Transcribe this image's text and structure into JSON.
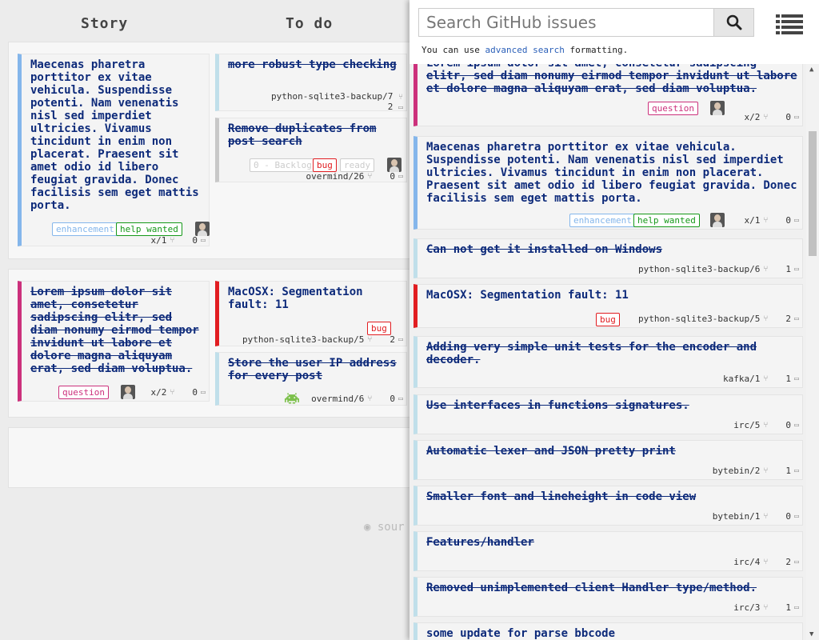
{
  "board": {
    "columns": {
      "story": "Story",
      "todo": "To do"
    },
    "source_link": "sour",
    "cards": {
      "story1": {
        "title": "Maecenas pharetra porttitor ex vitae vehicula. Suspendisse potenti. Nam venenatis nisl sed imperdiet ultricies. Vivamus tincidunt in enim non placerat. Praesent sit amet odio id libero feugiat gravida. Donec facilisis sem eget mattis porta.",
        "labels": [
          "enhancement",
          "help wanted"
        ],
        "ref": "x/1",
        "comments": "0"
      },
      "todo1": {
        "title": "more robust type checking",
        "ref": "python-sqlite3-backup/7",
        "comments": "2"
      },
      "todo2": {
        "title": "Remove duplicates from post search",
        "labels": [
          "0 - Backlog",
          "bug",
          "ready"
        ],
        "ref": "overmind/26",
        "comments": "0"
      },
      "story2": {
        "title": "Lorem ipsum dolor sit amet, consetetur sadipscing elitr, sed diam nonumy eirmod tempor invidunt ut labore et dolore magna aliquyam erat, sed diam voluptua.",
        "labels": [
          "question"
        ],
        "ref": "x/2",
        "comments": "0"
      },
      "todo3": {
        "title": "MacOSX: Segmentation fault: 11",
        "labels": [
          "bug"
        ],
        "ref": "python-sqlite3-backup/5",
        "comments": "2"
      },
      "todo4": {
        "title": "Store the user IP address for every post",
        "ref": "overmind/6",
        "comments": "0"
      }
    }
  },
  "search": {
    "placeholder": "Search GitHub issues",
    "hint_prefix": "You can use",
    "hint_link": "advanced search",
    "hint_suffix": "formatting."
  },
  "results": [
    {
      "title": "Lorem ipsum dolor sit amet, consetetur sadipscing elitr, sed diam nonumy eirmod tempor invidunt ut labore et dolore magna aliquyam erat, sed diam voluptua.",
      "label": "question",
      "ref": "x/2",
      "comments": "0"
    },
    {
      "title": "Maecenas pharetra porttitor ex vitae vehicula. Suspendisse potenti. Nam venenatis nisl sed imperdiet ultricies. Vivamus tincidunt in enim non placerat. Praesent sit amet odio id libero feugiat gravida. Donec facilisis sem eget mattis porta.",
      "labels": [
        "enhancement",
        "help wanted"
      ],
      "ref": "x/1",
      "comments": "0"
    },
    {
      "title": "Can not get it installed on Windows",
      "ref": "python-sqlite3-backup/6",
      "comments": "1"
    },
    {
      "title": "MacOSX: Segmentation fault: 11",
      "label": "bug",
      "ref": "python-sqlite3-backup/5",
      "comments": "2"
    },
    {
      "title": "Adding very simple unit tests for the encoder and decoder.",
      "ref": "kafka/1",
      "comments": "1"
    },
    {
      "title": "Use interfaces in functions signatures.",
      "ref": "irc/5",
      "comments": "0"
    },
    {
      "title": "Automatic lexer and JSON pretty print",
      "ref": "bytebin/2",
      "comments": "1"
    },
    {
      "title": "Smaller font and lineheight in code view",
      "ref": "bytebin/1",
      "comments": "0"
    },
    {
      "title": "Features/handler",
      "ref": "irc/4",
      "comments": "2"
    },
    {
      "title": "Removed unimplemented client Handler type/method.",
      "ref": "irc/3",
      "comments": "1"
    },
    {
      "title": "some update for parse bbcode"
    }
  ],
  "icons": {
    "search": "search-icon",
    "list": "list-icon",
    "pr": "pull-request-icon",
    "comment": "comment-icon",
    "avatar": "avatar-icon",
    "invader": "invader-icon",
    "github": "github-icon"
  },
  "colors": {
    "enhancement": "#84b6eb",
    "help_wanted": "#159818",
    "bug": "#e11d21",
    "question": "#cc317c",
    "title": "#0d2a7a"
  }
}
